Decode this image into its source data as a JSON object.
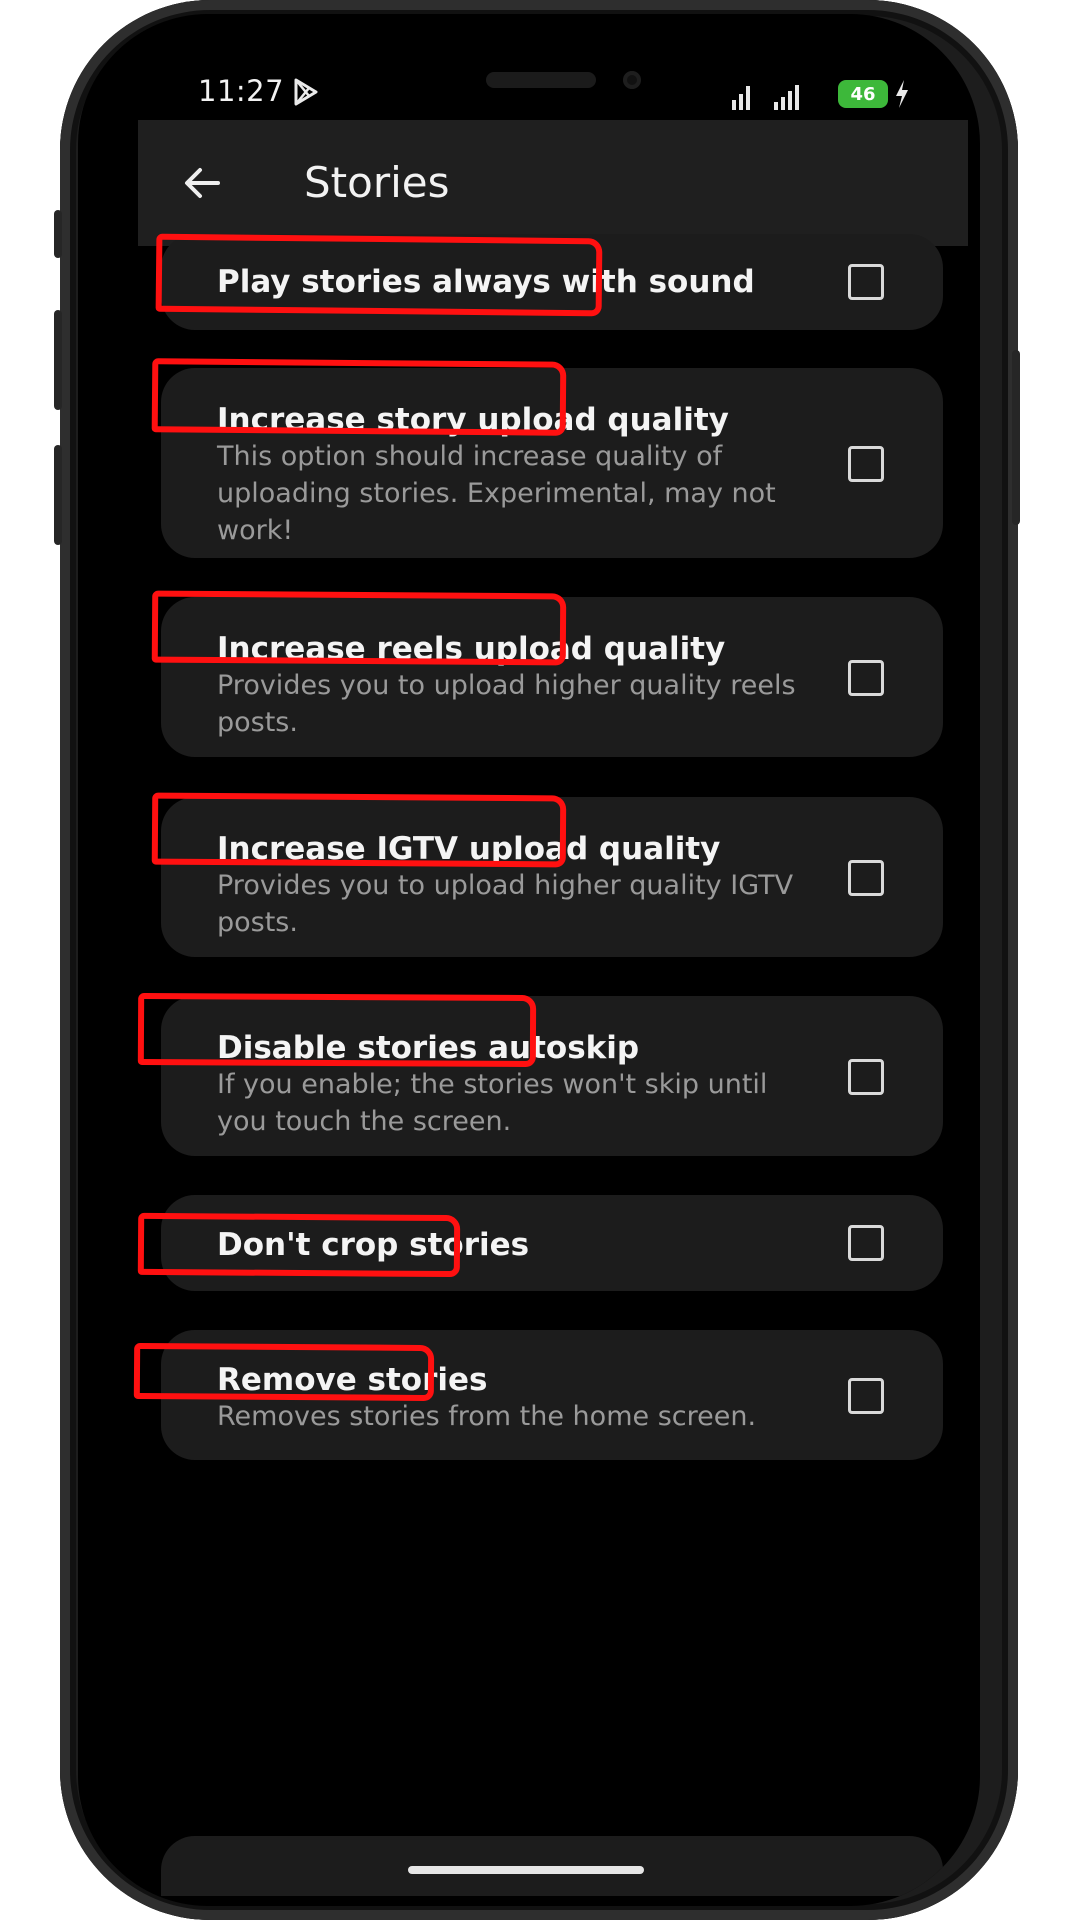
{
  "status_bar": {
    "time": "11:27",
    "battery": "46",
    "icons": [
      "play-store-icon",
      "signal-icon",
      "signal-icon",
      "battery-icon",
      "charging-icon"
    ]
  },
  "app_bar": {
    "back_icon": "arrow-left-icon",
    "title": "Stories"
  },
  "settings": [
    {
      "label": "Play stories always with sound",
      "description": "",
      "checked": false
    },
    {
      "label": "Increase story upload quality",
      "description": "This option should increase quality of uploading stories. Experimental, may not work!",
      "checked": false
    },
    {
      "label": "Increase reels upload quality",
      "description": "Provides you to upload higher quality reels posts.",
      "checked": false
    },
    {
      "label": "Increase IGTV upload quality",
      "description": "Provides you to upload higher quality IGTV posts.",
      "checked": false
    },
    {
      "label": "Disable stories autoskip",
      "description": "If you enable; the stories won't skip until you touch the screen.",
      "checked": false
    },
    {
      "label": "Don't crop stories",
      "description": "",
      "checked": false
    },
    {
      "label": "Remove stories",
      "description": "Removes stories from the home screen.",
      "checked": false
    }
  ],
  "colors": {
    "background": "#000000",
    "card": "#1c1c1c",
    "app_bar": "#1f1f1f",
    "highlight": "#ff1010",
    "battery": "#3db83a"
  }
}
